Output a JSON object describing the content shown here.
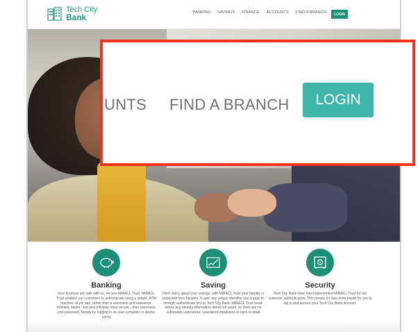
{
  "brand": {
    "line1": "Tech City",
    "line2": "Bank",
    "color": "#1d9b86"
  },
  "nav": {
    "items": [
      "BANKING",
      "SAVINGS",
      "FINANCE",
      "ACCOUNTS",
      "FIND A BRANCH"
    ],
    "login": "LOGIN",
    "login_color": "#1d8f78"
  },
  "zoom_callout": {
    "accounts_fragment": "UNTS",
    "find_branch": "FIND A BRANCH",
    "login": "LOGIN",
    "border_color": "#f2321c",
    "login_color": "#3fb6a9"
  },
  "features": [
    {
      "icon": "piggy-bank-icon",
      "title": "Banking",
      "text": "Your finances are safe with us, we use MIRACL Trust. MIRACL Trust enables our customers to authenticate using a simple, ATM machine UI pin pad, rather than a username and password. Infinitely easier - but also infinitely more secure - than username and password. Simply by logging in on your computer or device using"
    },
    {
      "icon": "growth-chart-icon",
      "title": "Saving",
      "text": "Don't worry about your savings, with MIRACL Trust your identity is protected from hackers. It uses any unique identifier you supply to strongly authenticate you to Tech City Bank. MIRACL Trust never stores any identity information about our users, so there are no vulnerable usernames / password databases to hack or steal"
    },
    {
      "icon": "safe-vault-icon",
      "title": "Security",
      "text": "Tech City Bank have now implemented MIRACL Trust for our customer authentication. This means it's now even easier for you to log in and access your Tech City Bank account."
    }
  ]
}
